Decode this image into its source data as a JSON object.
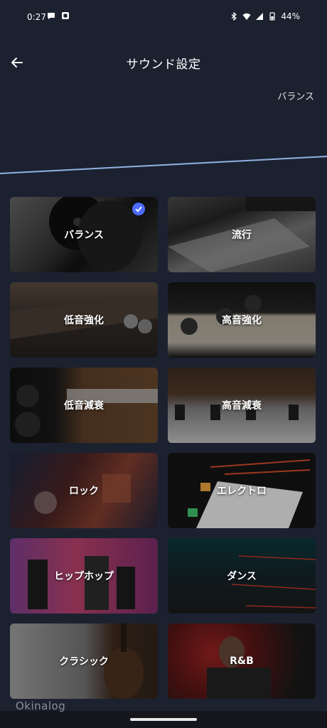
{
  "status_bar": {
    "time": "0:27",
    "left_icons": [
      "message-icon",
      "app-icon"
    ],
    "right_icons": [
      "bluetooth-icon",
      "wifi-icon",
      "signal-icon",
      "battery-icon"
    ],
    "battery": "44%"
  },
  "header": {
    "title": "サウンド設定",
    "back_icon": "arrow-left-icon"
  },
  "current_preset": "バランス",
  "colors": {
    "background": "#1c2130",
    "eq_line": "#8fb3e0",
    "check_badge": "#4d6bff"
  },
  "presets": [
    {
      "label": "バランス",
      "selected": true
    },
    {
      "label": "流行",
      "selected": false
    },
    {
      "label": "低音強化",
      "selected": false
    },
    {
      "label": "高音強化",
      "selected": false
    },
    {
      "label": "低音減衰",
      "selected": false
    },
    {
      "label": "高音減衰",
      "selected": false
    },
    {
      "label": "ロック",
      "selected": false
    },
    {
      "label": "エレクトロ",
      "selected": false
    },
    {
      "label": "ヒップホップ",
      "selected": false
    },
    {
      "label": "ダンス",
      "selected": false
    },
    {
      "label": "クラシック",
      "selected": false
    },
    {
      "label": "R&B",
      "selected": false
    }
  ],
  "watermark": "Okinalog"
}
